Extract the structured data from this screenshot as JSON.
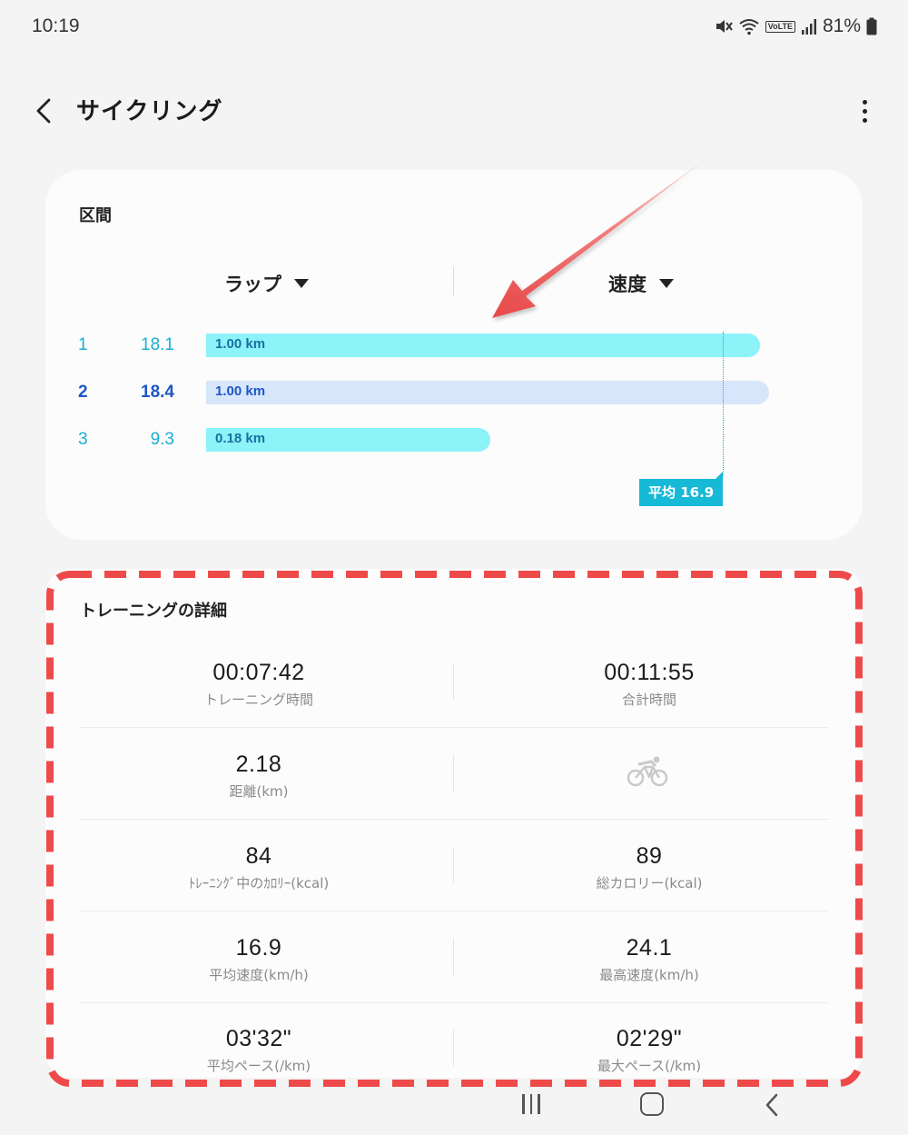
{
  "status_bar": {
    "time": "10:19",
    "volte": "VoLTE",
    "battery": "81%",
    "icons": [
      "mute-icon",
      "wifi-icon",
      "volte-icon",
      "signal-icon",
      "battery-icon"
    ]
  },
  "header": {
    "title": "サイクリング",
    "back_icon": "chevron-left-icon",
    "menu_icon": "more-vert-icon"
  },
  "laps": {
    "heading": "区間",
    "col_left": "ラップ",
    "col_right": "速度",
    "rows": [
      {
        "num": "1",
        "speed": "18.1",
        "distance": "1.00 km",
        "speed_value": 18.1,
        "active": false
      },
      {
        "num": "2",
        "speed": "18.4",
        "distance": "1.00 km",
        "speed_value": 18.4,
        "active": true
      },
      {
        "num": "3",
        "speed": "9.3",
        "distance": "0.18 km",
        "speed_value": 9.3,
        "active": false
      }
    ],
    "average_label": "平均 16.9",
    "average_value": 16.9,
    "colors": {
      "bar": "#8cf3f8",
      "bar_active": "#d7e6fb",
      "accent": "#1aaed3",
      "active_text": "#1f56c7"
    }
  },
  "details": {
    "heading": "トレーニングの詳細",
    "rows": [
      [
        {
          "value": "00:07:42",
          "label": "トレーニング時間"
        },
        {
          "value": "00:11:55",
          "label": "合計時間"
        }
      ],
      [
        {
          "value": "2.18",
          "label": "距離(km)"
        },
        {
          "icon": "cycling-icon"
        }
      ],
      [
        {
          "value": "84",
          "label": "ﾄﾚｰﾆﾝｸﾞ中のｶﾛﾘｰ(kcal)"
        },
        {
          "value": "89",
          "label": "総カロリー(kcal)"
        }
      ],
      [
        {
          "value": "16.9",
          "label": "平均速度(km/h)"
        },
        {
          "value": "24.1",
          "label": "最高速度(km/h)"
        }
      ],
      [
        {
          "value": "03'32\"",
          "label": "平均ペース(/km)"
        },
        {
          "value": "02'29\"",
          "label": "最大ペース(/km)"
        }
      ]
    ]
  },
  "annotations": {
    "arrow_color": "#ee5a5a",
    "frame_color": "#ee4a4a"
  },
  "nav_bar": {
    "icons": [
      "recents-icon",
      "home-icon",
      "back-icon"
    ]
  }
}
